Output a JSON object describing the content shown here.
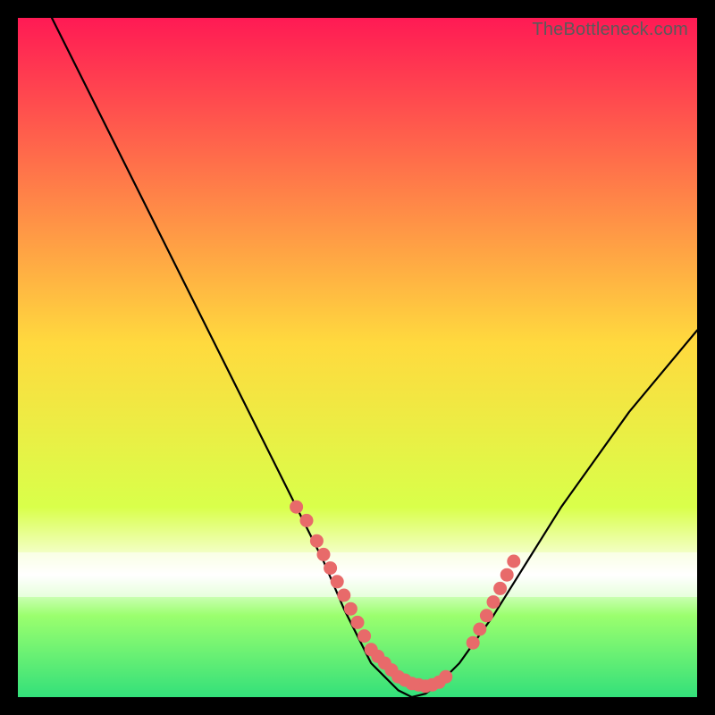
{
  "watermark": "TheBottleneck.com",
  "colors": {
    "bg": "#000000",
    "curve": "#000000",
    "marker": "#e86a6a",
    "gradient_top": "#ff1a54",
    "gradient_mid": "#ffda3e",
    "gradient_low": "#d9ff4a",
    "gradient_bottom": "#33e07a",
    "white_band": "#ffffff"
  },
  "chart_data": {
    "type": "line",
    "title": "",
    "xlabel": "",
    "ylabel": "",
    "xlim": [
      0,
      100
    ],
    "ylim": [
      0,
      100
    ],
    "series": [
      {
        "name": "bottleneck-curve",
        "x": [
          5,
          10,
          15,
          20,
          25,
          30,
          35,
          40,
          45,
          48,
          50,
          52,
          54,
          56,
          58,
          60,
          62,
          65,
          70,
          75,
          80,
          85,
          90,
          95,
          100
        ],
        "y": [
          100,
          90,
          80,
          70,
          60,
          50,
          40,
          30,
          20,
          13,
          9,
          5,
          3,
          1,
          0,
          0.5,
          2,
          5,
          12,
          20,
          28,
          35,
          42,
          48,
          54
        ]
      }
    ],
    "markers": [
      {
        "name": "cluster-left",
        "x": [
          41,
          42.5,
          44,
          45,
          46,
          47,
          48,
          49,
          50,
          51,
          52,
          53,
          54,
          55,
          56,
          57,
          58,
          59,
          60,
          61,
          62,
          63
        ],
        "y": [
          28,
          26,
          23,
          21,
          19,
          17,
          15,
          13,
          11,
          9,
          7,
          6,
          5,
          4,
          3,
          2.5,
          2,
          1.8,
          1.6,
          1.8,
          2.2,
          3
        ]
      },
      {
        "name": "cluster-right",
        "x": [
          67,
          68,
          69,
          70,
          71,
          72,
          73
        ],
        "y": [
          8,
          10,
          12,
          14,
          16,
          18,
          20
        ]
      }
    ]
  }
}
